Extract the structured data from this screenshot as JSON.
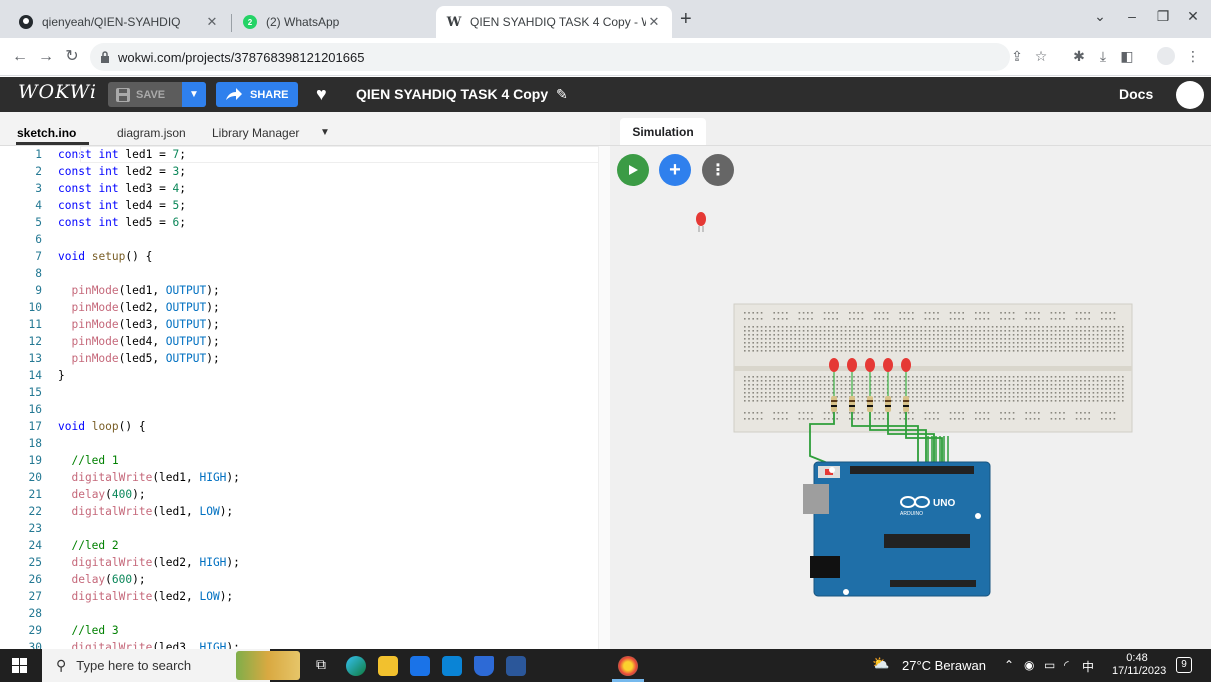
{
  "browser": {
    "tabs": [
      {
        "title": "qienyeah/QIEN-SYAHDIQ",
        "icon": "github-icon"
      },
      {
        "title": "(2) WhatsApp",
        "icon": "whatsapp-icon"
      },
      {
        "title": "QIEN SYAHDIQ TASK 4 Copy - W",
        "icon": "wokwi-icon"
      }
    ],
    "url": "wokwi.com/projects/378768398121201665"
  },
  "wokwi": {
    "logo": "WOKWi",
    "save_label": "SAVE",
    "share_label": "SHARE",
    "project_title": "QIEN SYAHDIQ TASK 4 Copy",
    "docs_label": "Docs"
  },
  "editor": {
    "tabs": [
      "sketch.ino",
      "diagram.json",
      "Library Manager"
    ],
    "lines": [
      "const int led1 = 7;",
      "const int led2 = 3;",
      "const int led3 = 4;",
      "const int led4 = 5;",
      "const int led5 = 6;",
      "",
      "void setup() {",
      "",
      "  pinMode(led1, OUTPUT);",
      "  pinMode(led2, OUTPUT);",
      "  pinMode(led3, OUTPUT);",
      "  pinMode(led4, OUTPUT);",
      "  pinMode(led5, OUTPUT);",
      "}",
      "",
      "",
      "void loop() {",
      "",
      "  //led 1",
      "  digitalWrite(led1, HIGH);",
      "  delay(400);",
      "  digitalWrite(led1, LOW);",
      "",
      "  //led 2",
      "  digitalWrite(led2, HIGH);",
      "  delay(600);",
      "  digitalWrite(led2, LOW);",
      "",
      "  //led 3",
      "  digitalWrite(led3, HIGH);"
    ]
  },
  "simulation": {
    "tab_label": "Simulation",
    "board_label": "UNO",
    "board_sub": "ARDUINO"
  },
  "taskbar": {
    "search_placeholder": "Type here to search",
    "weather": "27°C  Berawan",
    "time": "0:48",
    "date": "17/11/2023",
    "notifications": "9"
  },
  "colors": {
    "wokwi_header": "#2d2d2d",
    "accent_blue": "#2f80ed",
    "run_green": "#3b9b45",
    "led_red": "#e53935"
  }
}
